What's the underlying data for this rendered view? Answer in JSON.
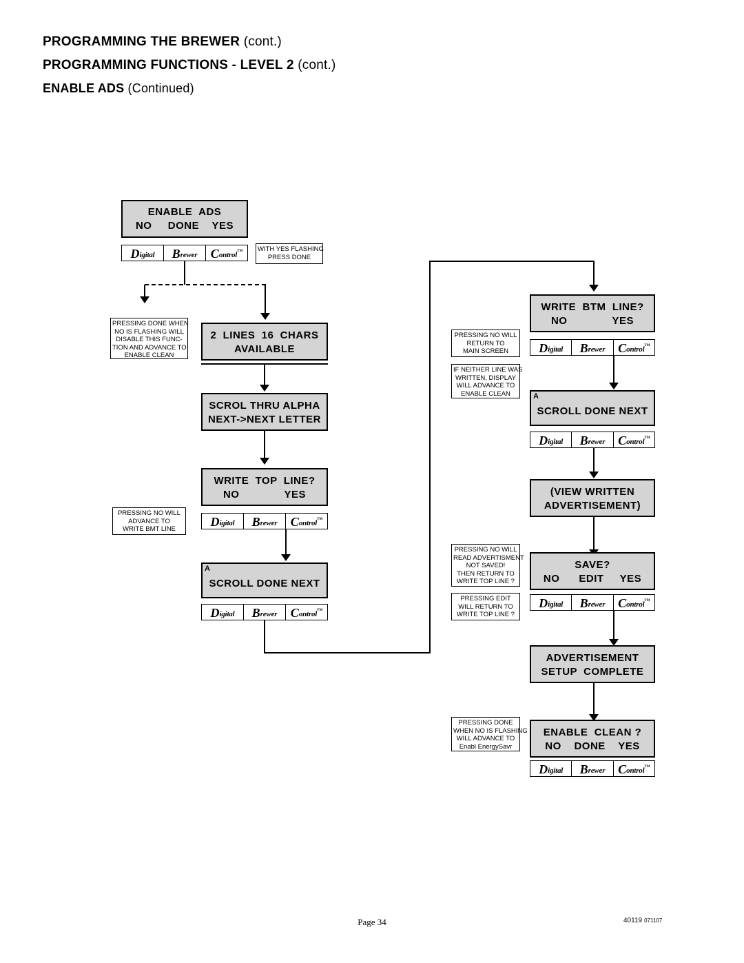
{
  "headings": {
    "line1_bold": "PROGRAMMING THE BREWER",
    "line1_light": "(cont.)",
    "line2_bold": "PROGRAMMING FUNCTIONS - LEVEL  2",
    "line2_light": "(cont.)",
    "line3_bold": "ENABLE ADS",
    "line3_light": "(Continued)"
  },
  "logo": {
    "seg1_cap": "D",
    "seg1_rest": "igital",
    "seg2_cap": "B",
    "seg2_rest": "rewer",
    "seg3_cap": "C",
    "seg3_rest": "ontrol",
    "tm": "TM"
  },
  "screens": {
    "enable_ads": {
      "l1": "ENABLE  ADS",
      "l2": "NO     DONE    YES"
    },
    "lines_chars": {
      "l1": "2  LINES  16  CHARS",
      "l2": "AVAILABLE"
    },
    "scroll_alpha": {
      "l1": "SCROL THRU ALPHA",
      "l2": "NEXT->NEXT LETTER"
    },
    "write_top": {
      "l1": "WRITE  TOP  LINE?",
      "l2": "NO              YES"
    },
    "scroll_done_next_1": {
      "l1": "SCROLL DONE NEXT",
      "marker": "A"
    },
    "write_btm": {
      "l1": "WRITE  BTM  LINE?",
      "l2": "NO              YES"
    },
    "scroll_done_next_2": {
      "l1": "SCROLL DONE NEXT",
      "marker": "A"
    },
    "view_written": {
      "l1": "(VIEW WRITTEN",
      "l2": "ADVERTISEMENT)"
    },
    "save": {
      "l1": "SAVE?",
      "l2": "NO      EDIT     YES"
    },
    "ad_setup_complete": {
      "l1": "ADVERTISEMENT",
      "l2": "SETUP  COMPLETE"
    },
    "enable_clean": {
      "l1": "ENABLE  CLEAN ?",
      "l2": "NO    DONE    YES"
    }
  },
  "notes": {
    "with_yes_flashing": [
      "WITH YES FLASHING",
      "PRESS DONE"
    ],
    "pressing_done_disable": [
      "PRESSING DONE WHEN",
      "NO IS FLASHING WILL",
      "DISABLE THIS FUNC-",
      "TION AND ADVANCE TO",
      "ENABLE CLEAN"
    ],
    "pressing_no_advance_btm": [
      "PRESSING NO WILL",
      "ADVANCE TO",
      "WRITE BMT LINE"
    ],
    "pressing_no_return_main": [
      "PRESSING NO WILL",
      "RETURN TO",
      "MAIN SCREEN"
    ],
    "if_neither_line": [
      "IF NEITHER LINE WAS",
      "WRITTEN, DISPLAY",
      "WILL ADVANCE TO",
      "ENABLE CLEAN"
    ],
    "pressing_no_read_ad": [
      "PRESSING NO WILL",
      "READ ADVERTISMENT",
      "NOT SAVED!",
      "THEN RETURN TO",
      "WRITE TOP LINE ?"
    ],
    "pressing_edit_return": [
      "PRESSING EDIT",
      "WILL RETURN TO",
      "WRITE TOP LINE ?"
    ],
    "pressing_done_energysavr": [
      "PRESSING DONE",
      "WHEN NO IS FLASHING",
      "WILL ADVANCE TO",
      "Enabl EnergySavr"
    ]
  },
  "footer": {
    "page": "Page 34",
    "doc_number": "40119",
    "doc_rev": "071107"
  }
}
